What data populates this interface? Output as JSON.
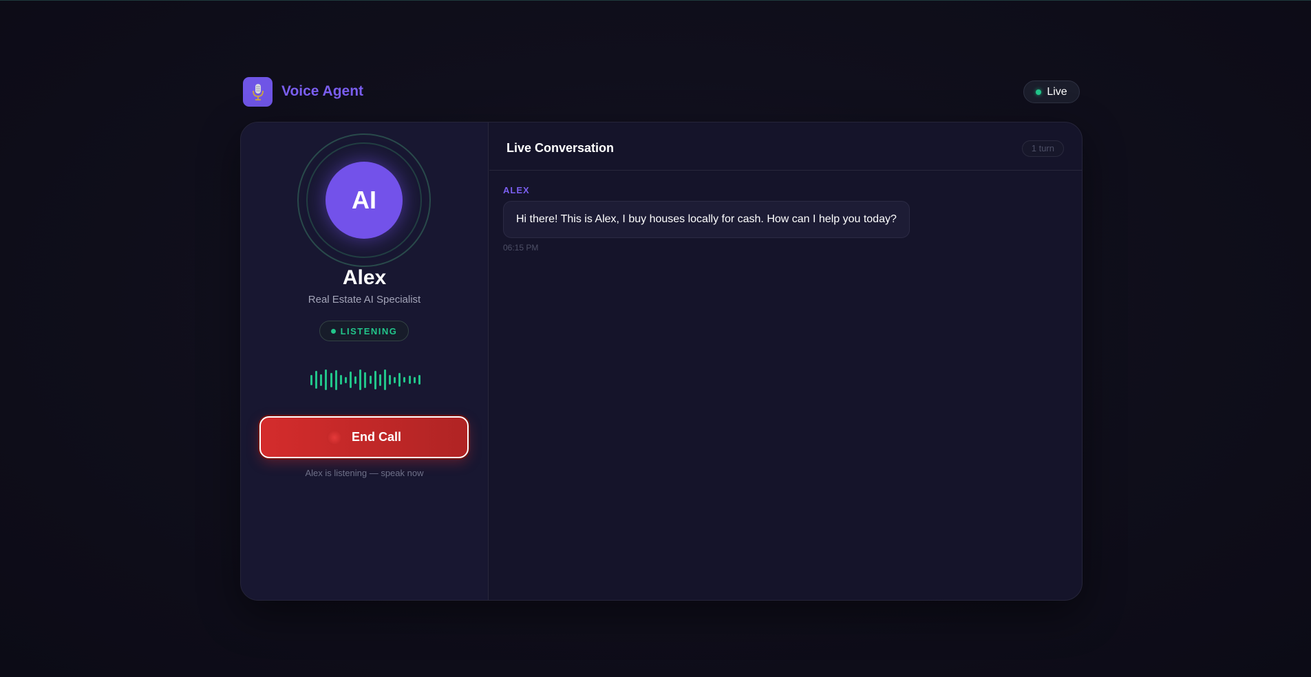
{
  "app": {
    "title": "Voice Agent",
    "icon": "microphone-icon",
    "status": "Live"
  },
  "agent": {
    "avatar_text": "AI",
    "name": "Alex",
    "role": "Real Estate AI Specialist",
    "status": "LISTENING",
    "waveform_levels": [
      0.5,
      0.85,
      0.55,
      1.0,
      0.7,
      0.95,
      0.45,
      0.3,
      0.8,
      0.35,
      1.0,
      0.75,
      0.4,
      0.9,
      0.55,
      1.0,
      0.45,
      0.3,
      0.65,
      0.25,
      0.4,
      0.3,
      0.45
    ]
  },
  "controls": {
    "end_call_label": "End Call",
    "hint": "Alex is listening — speak now"
  },
  "conversation": {
    "title": "Live Conversation",
    "turn_count": "1 turn",
    "messages": [
      {
        "speaker": "ALEX",
        "text": "Hi there! This is Alex, I buy houses locally for cash. How can I help you today?",
        "time": "06:15 PM"
      }
    ]
  },
  "colors": {
    "accent": "#7352ea",
    "live_green": "#22c58a",
    "end_call_red": "#d42c2c"
  }
}
